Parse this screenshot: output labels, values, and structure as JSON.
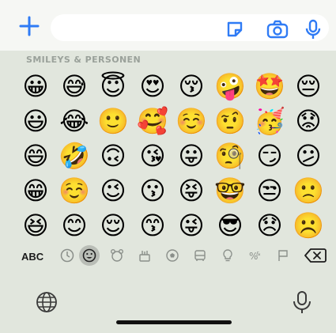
{
  "section_title": "SMILEYS & PERSONEN",
  "emoji_rows": [
    [
      "😀",
      "😅",
      "😇",
      "😍",
      "😚",
      "🤪",
      "🤩",
      "😔"
    ],
    [
      "😃",
      "😂",
      "🙂",
      "🥰",
      "☺️",
      "🤨",
      "🥳",
      "😟"
    ],
    [
      "😄",
      "🤣",
      "🙃",
      "😘",
      "😛",
      "🧐",
      "😏",
      "😕"
    ],
    [
      "😁",
      "☺️",
      "😉",
      "😗",
      "😝",
      "🤓",
      "😒",
      "🙁"
    ],
    [
      "😆",
      "😊",
      "😌",
      "😙",
      "😜",
      "😎",
      "😞",
      "☹️"
    ]
  ],
  "category_bar": {
    "abc_label": "ABC",
    "icons": [
      "clock-icon",
      "smiley-icon",
      "animal-icon",
      "food-icon",
      "sports-icon",
      "travel-icon",
      "objects-icon",
      "symbols-icon",
      "flag-icon"
    ],
    "active": "smiley-icon"
  },
  "colors": {
    "accent": "#2f7bf5",
    "keyboard_bg": "#e1e6dd"
  }
}
